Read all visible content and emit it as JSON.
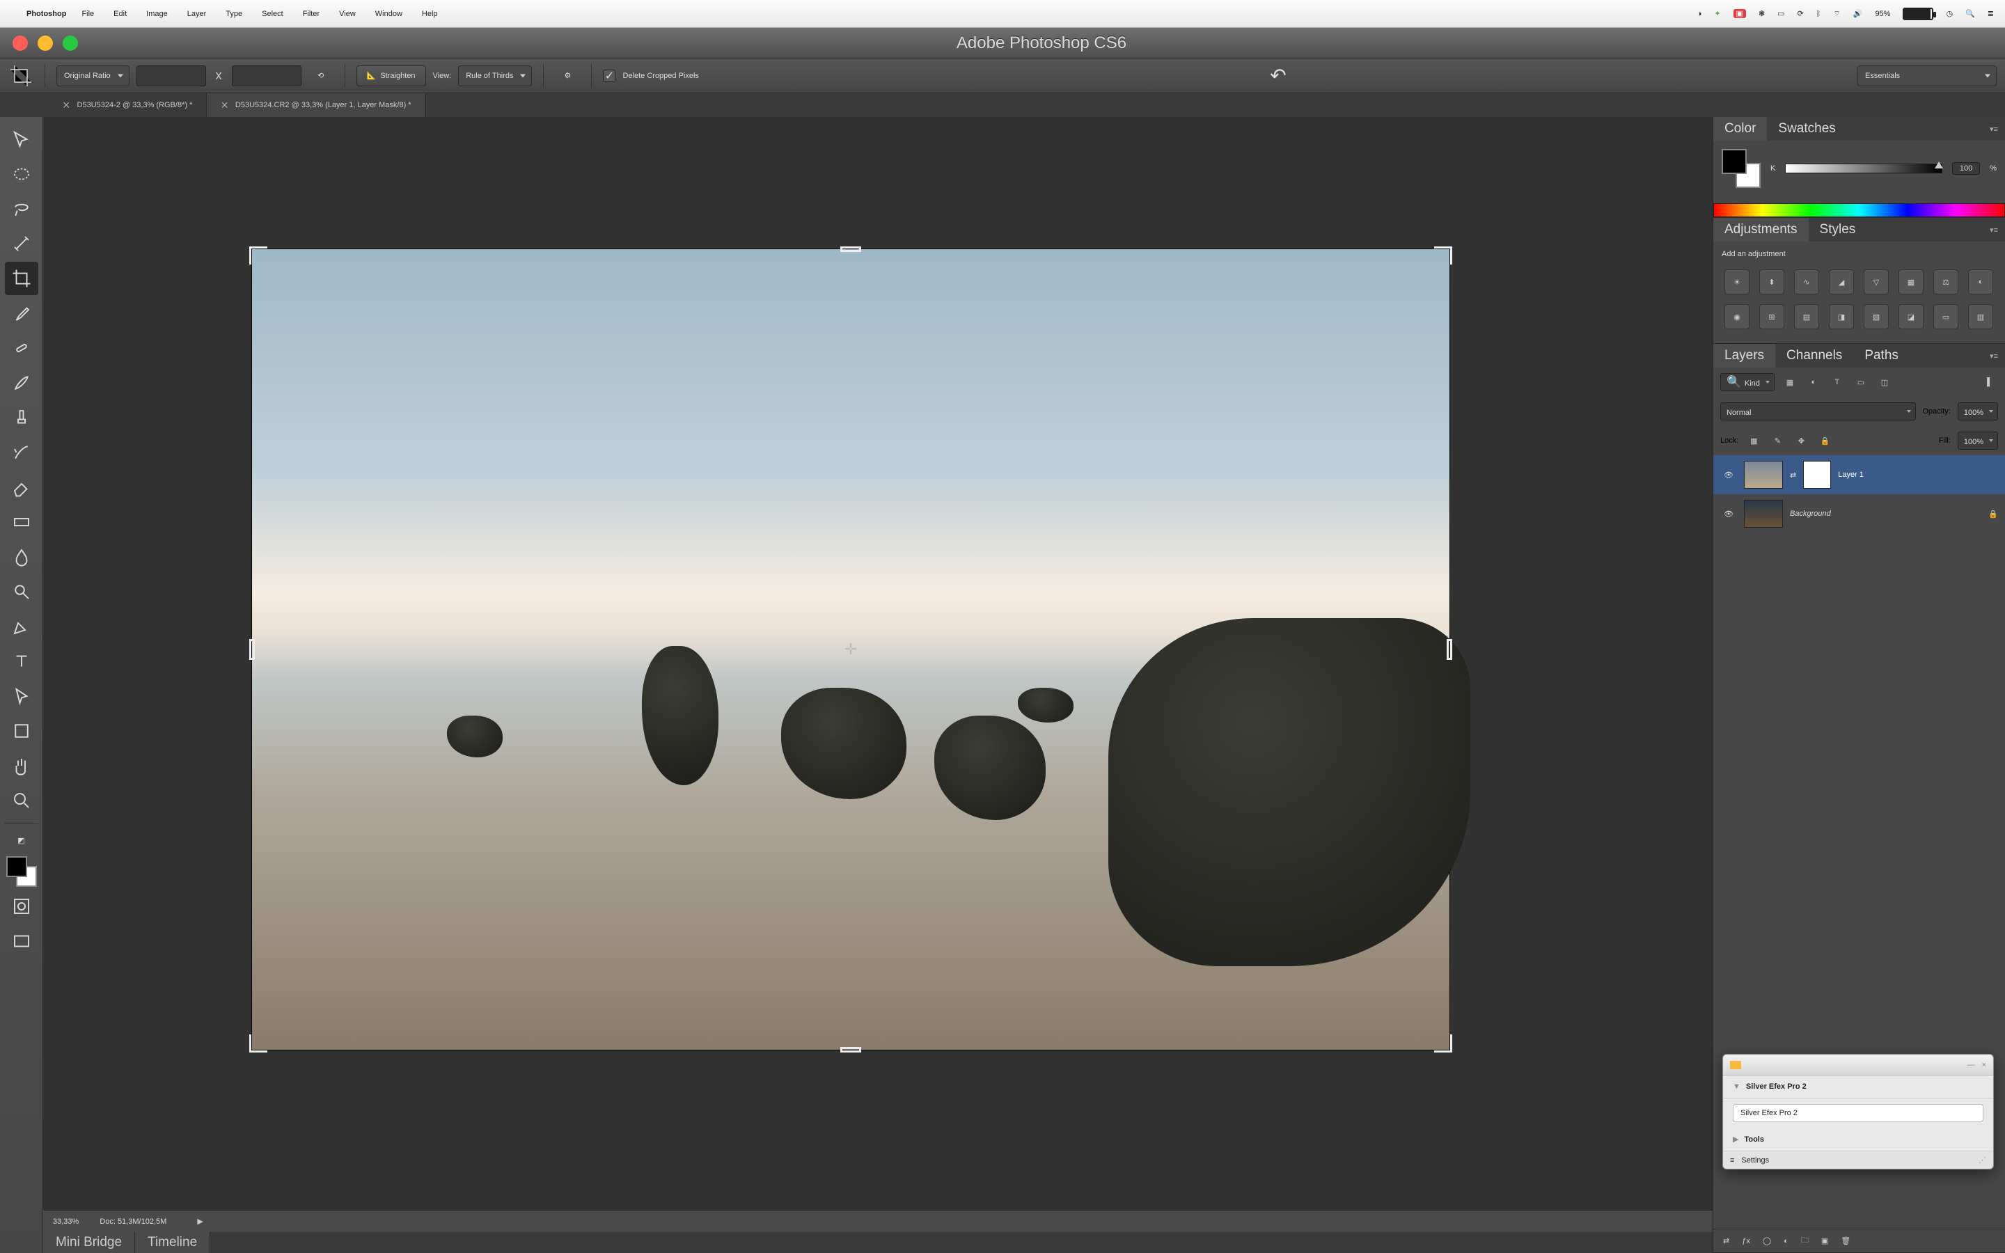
{
  "mac_menu": {
    "app": "Photoshop",
    "items": [
      "File",
      "Edit",
      "Image",
      "Layer",
      "Type",
      "Select",
      "Filter",
      "View",
      "Window",
      "Help"
    ],
    "battery": "95%"
  },
  "window": {
    "title": "Adobe Photoshop CS6"
  },
  "options_bar": {
    "ratio": "Original Ratio",
    "x": "x",
    "straighten": "Straighten",
    "view_label": "View:",
    "view_value": "Rule of Thirds",
    "delete_cropped": "Delete Cropped Pixels",
    "workspace": "Essentials"
  },
  "doc_tabs": [
    {
      "label": "D53U5324-2 @ 33,3% (RGB/8*) *",
      "active": false
    },
    {
      "label": "D53U5324.CR2 @ 33,3% (Layer 1, Layer Mask/8) *",
      "active": true
    }
  ],
  "tools": [
    "move",
    "marquee",
    "lasso",
    "wand",
    "crop",
    "eyedropper",
    "heal",
    "brush",
    "stamp",
    "history",
    "eraser",
    "gradient",
    "blur",
    "dodge",
    "pen",
    "type",
    "path",
    "shape",
    "hand",
    "zoom"
  ],
  "statusbar": {
    "zoom": "33,33%",
    "doc": "Doc: 51,3M/102,5M"
  },
  "bottom_tabs": [
    "Mini Bridge",
    "Timeline"
  ],
  "panels": {
    "color": {
      "tabs": [
        "Color",
        "Swatches"
      ],
      "k_label": "K",
      "value": "100",
      "pct": "%"
    },
    "adjustments": {
      "tabs": [
        "Adjustments",
        "Styles"
      ],
      "heading": "Add an adjustment"
    },
    "layers": {
      "tabs": [
        "Layers",
        "Channels",
        "Paths"
      ],
      "kind": "Kind",
      "blend": "Normal",
      "opacity_label": "Opacity:",
      "opacity": "100%",
      "lock_label": "Lock:",
      "fill_label": "Fill:",
      "fill": "100%",
      "rows": [
        {
          "name": "Layer 1",
          "mask": true,
          "locked": false,
          "sel": true
        },
        {
          "name": "Background",
          "mask": false,
          "locked": true,
          "sel": false,
          "italic": true
        }
      ]
    }
  },
  "plugin": {
    "title": "Silver Efex Pro 2",
    "preset": "Silver Efex Pro 2",
    "tools": "Tools",
    "settings": "Settings"
  }
}
